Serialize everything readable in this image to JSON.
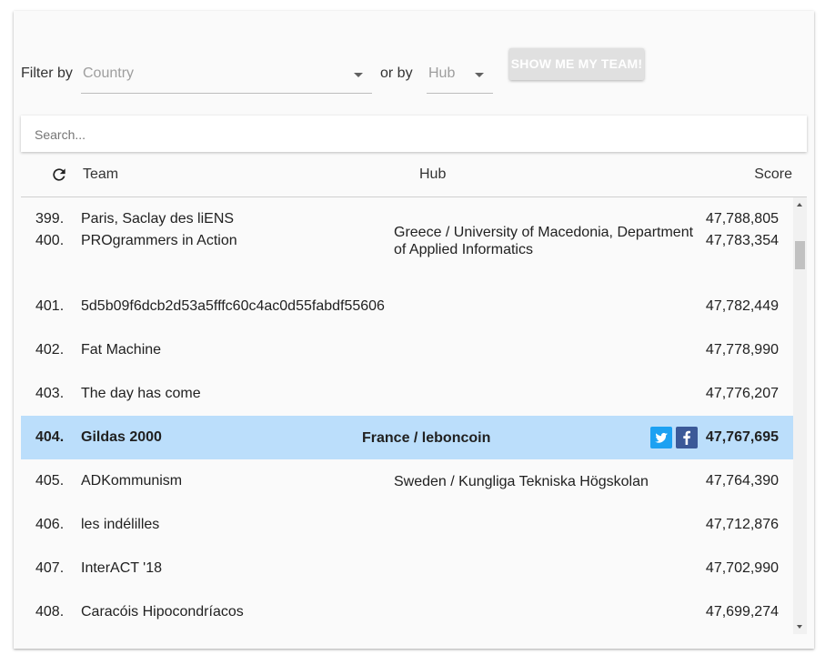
{
  "filters": {
    "filter_by_label": "Filter by",
    "country_placeholder": "Country",
    "or_by_label": "or by",
    "hub_placeholder": "Hub",
    "show_team_button": "SHOW ME MY TEAM!"
  },
  "search": {
    "placeholder": "Search..."
  },
  "table": {
    "headers": {
      "team": "Team",
      "hub": "Hub",
      "score": "Score"
    },
    "rows": [
      {
        "rank": "399.",
        "team": "Paris, Saclay des liENS",
        "hub": "",
        "score": "47,788,805"
      },
      {
        "rank": "400.",
        "team": "PROgrammers in Action",
        "hub": "Greece / University of Macedonia, Department of Applied Informatics",
        "score": "47,783,354"
      },
      {
        "rank": "401.",
        "team": "5d5b09f6dcb2d53a5fffc60c4ac0d55fabdf55606",
        "hub": "",
        "score": "47,782,449"
      },
      {
        "rank": "402.",
        "team": "Fat Machine",
        "hub": "",
        "score": "47,778,990"
      },
      {
        "rank": "403.",
        "team": "The day has come",
        "hub": "",
        "score": "47,776,207"
      },
      {
        "rank": "404.",
        "team": "Gildas 2000",
        "hub": "France / leboncoin",
        "score": "47,767,695",
        "highlighted": true
      },
      {
        "rank": "405.",
        "team": "ADKommunism",
        "hub": "Sweden / Kungliga Tekniska Högskolan",
        "score": "47,764,390"
      },
      {
        "rank": "406.",
        "team": "les indélilles",
        "hub": "",
        "score": "47,712,876"
      },
      {
        "rank": "407.",
        "team": "InterACT '18",
        "hub": "",
        "score": "47,702,990"
      },
      {
        "rank": "408.",
        "team": "Caracóis Hipocondríacos",
        "hub": "",
        "score": "47,699,274"
      }
    ]
  },
  "icons": {
    "refresh": "refresh-icon",
    "twitter": "twitter-icon",
    "facebook": "facebook-icon"
  },
  "colors": {
    "highlight_row": "#bbdefb",
    "twitter": "#1da1f2",
    "facebook": "#3b5998",
    "button_disabled": "#e0e0e0"
  }
}
